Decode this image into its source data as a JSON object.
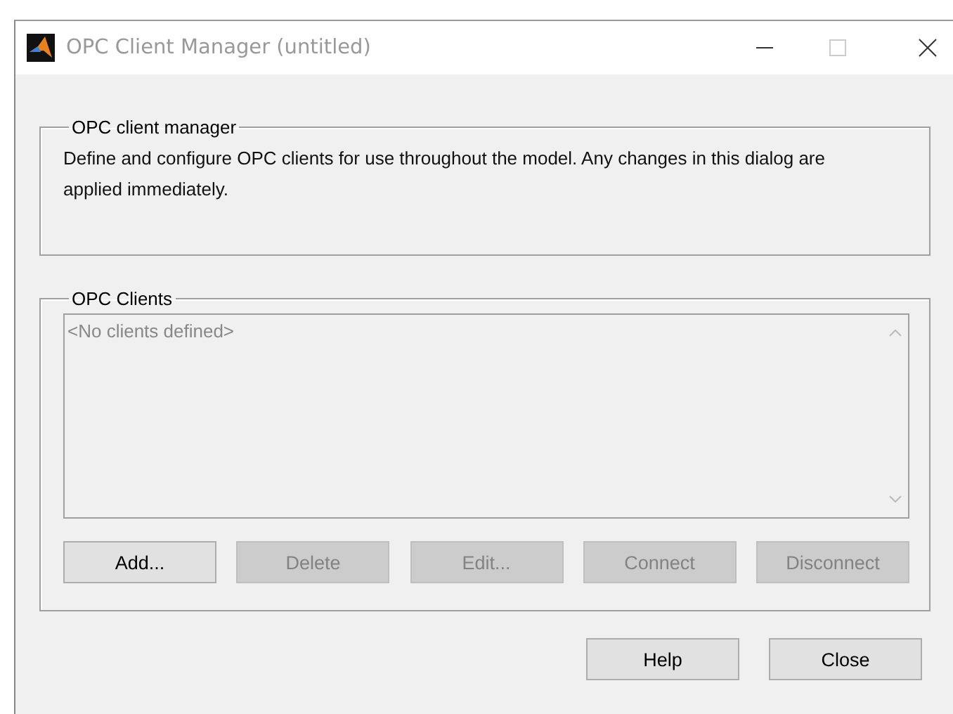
{
  "window": {
    "title": "OPC Client Manager (untitled)"
  },
  "manager_group": {
    "title": "OPC client manager",
    "description": "Define and configure OPC clients for use throughout the model. Any changes in this dialog are applied immediately."
  },
  "clients_group": {
    "title": "OPC Clients",
    "list": {
      "placeholder": "<No clients defined>"
    },
    "buttons": [
      {
        "label": "Add...",
        "disabled": false
      },
      {
        "label": "Delete",
        "disabled": true
      },
      {
        "label": "Edit...",
        "disabled": true
      },
      {
        "label": "Connect",
        "disabled": true
      },
      {
        "label": "Disconnect",
        "disabled": true
      }
    ]
  },
  "footer_buttons": [
    {
      "label": "Help"
    },
    {
      "label": "Close"
    }
  ]
}
